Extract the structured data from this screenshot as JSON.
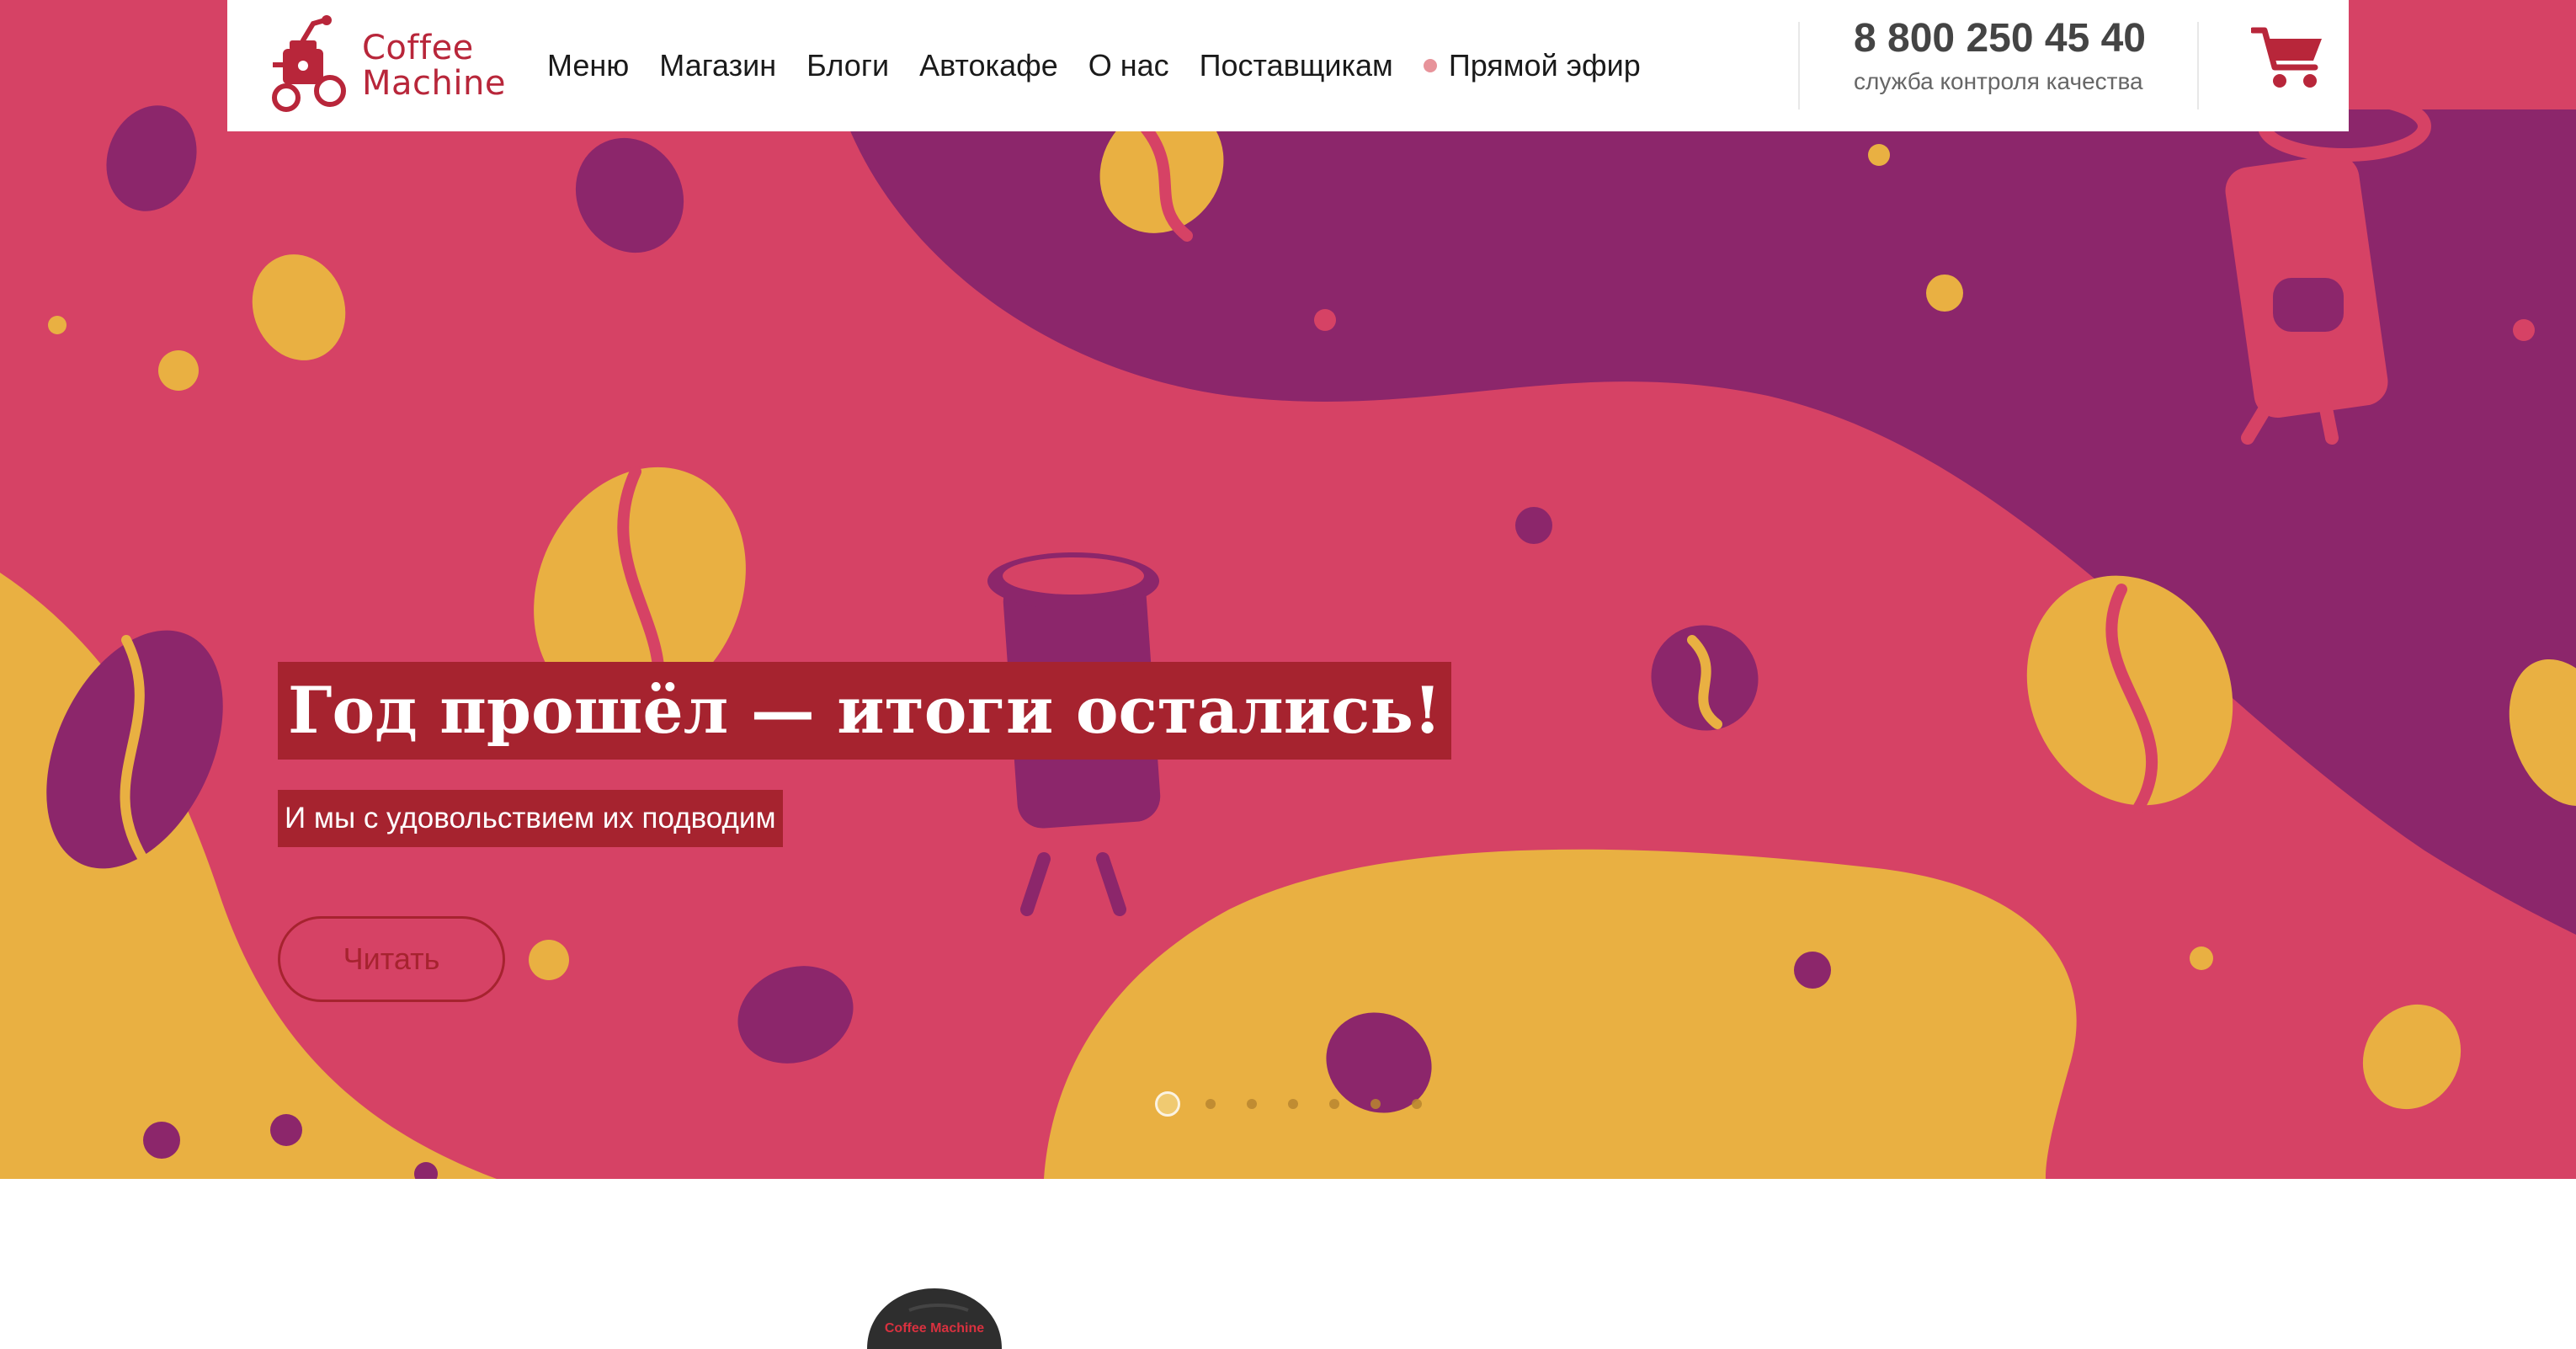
{
  "header": {
    "logo": {
      "line1": "Coffee",
      "line2": "Machine"
    },
    "nav": [
      {
        "label": "Меню"
      },
      {
        "label": "Магазин"
      },
      {
        "label": "Блоги"
      },
      {
        "label": "Автокафе"
      },
      {
        "label": "О нас"
      },
      {
        "label": "Поставщикам"
      }
    ],
    "live_label": "Прямой эфир",
    "phone": "8 800 250 45 40",
    "phone_caption": "служба контроля качества"
  },
  "hero": {
    "title": "Год прошёл — итоги остались!",
    "subtitle": "И мы с удовольствием их подводим",
    "button_label": "Читать",
    "slides_total": 7,
    "active_slide": 1
  },
  "product_image": {
    "text": "Coffee Machine"
  },
  "colors": {
    "hero_pink": "#d64265",
    "hero_purple": "#8c266b",
    "hero_yellow": "#e9b042",
    "brand_red": "#a6232f"
  },
  "icons": [
    "coffee-grinder-logo-icon",
    "cart-icon",
    "live-dot-icon"
  ]
}
